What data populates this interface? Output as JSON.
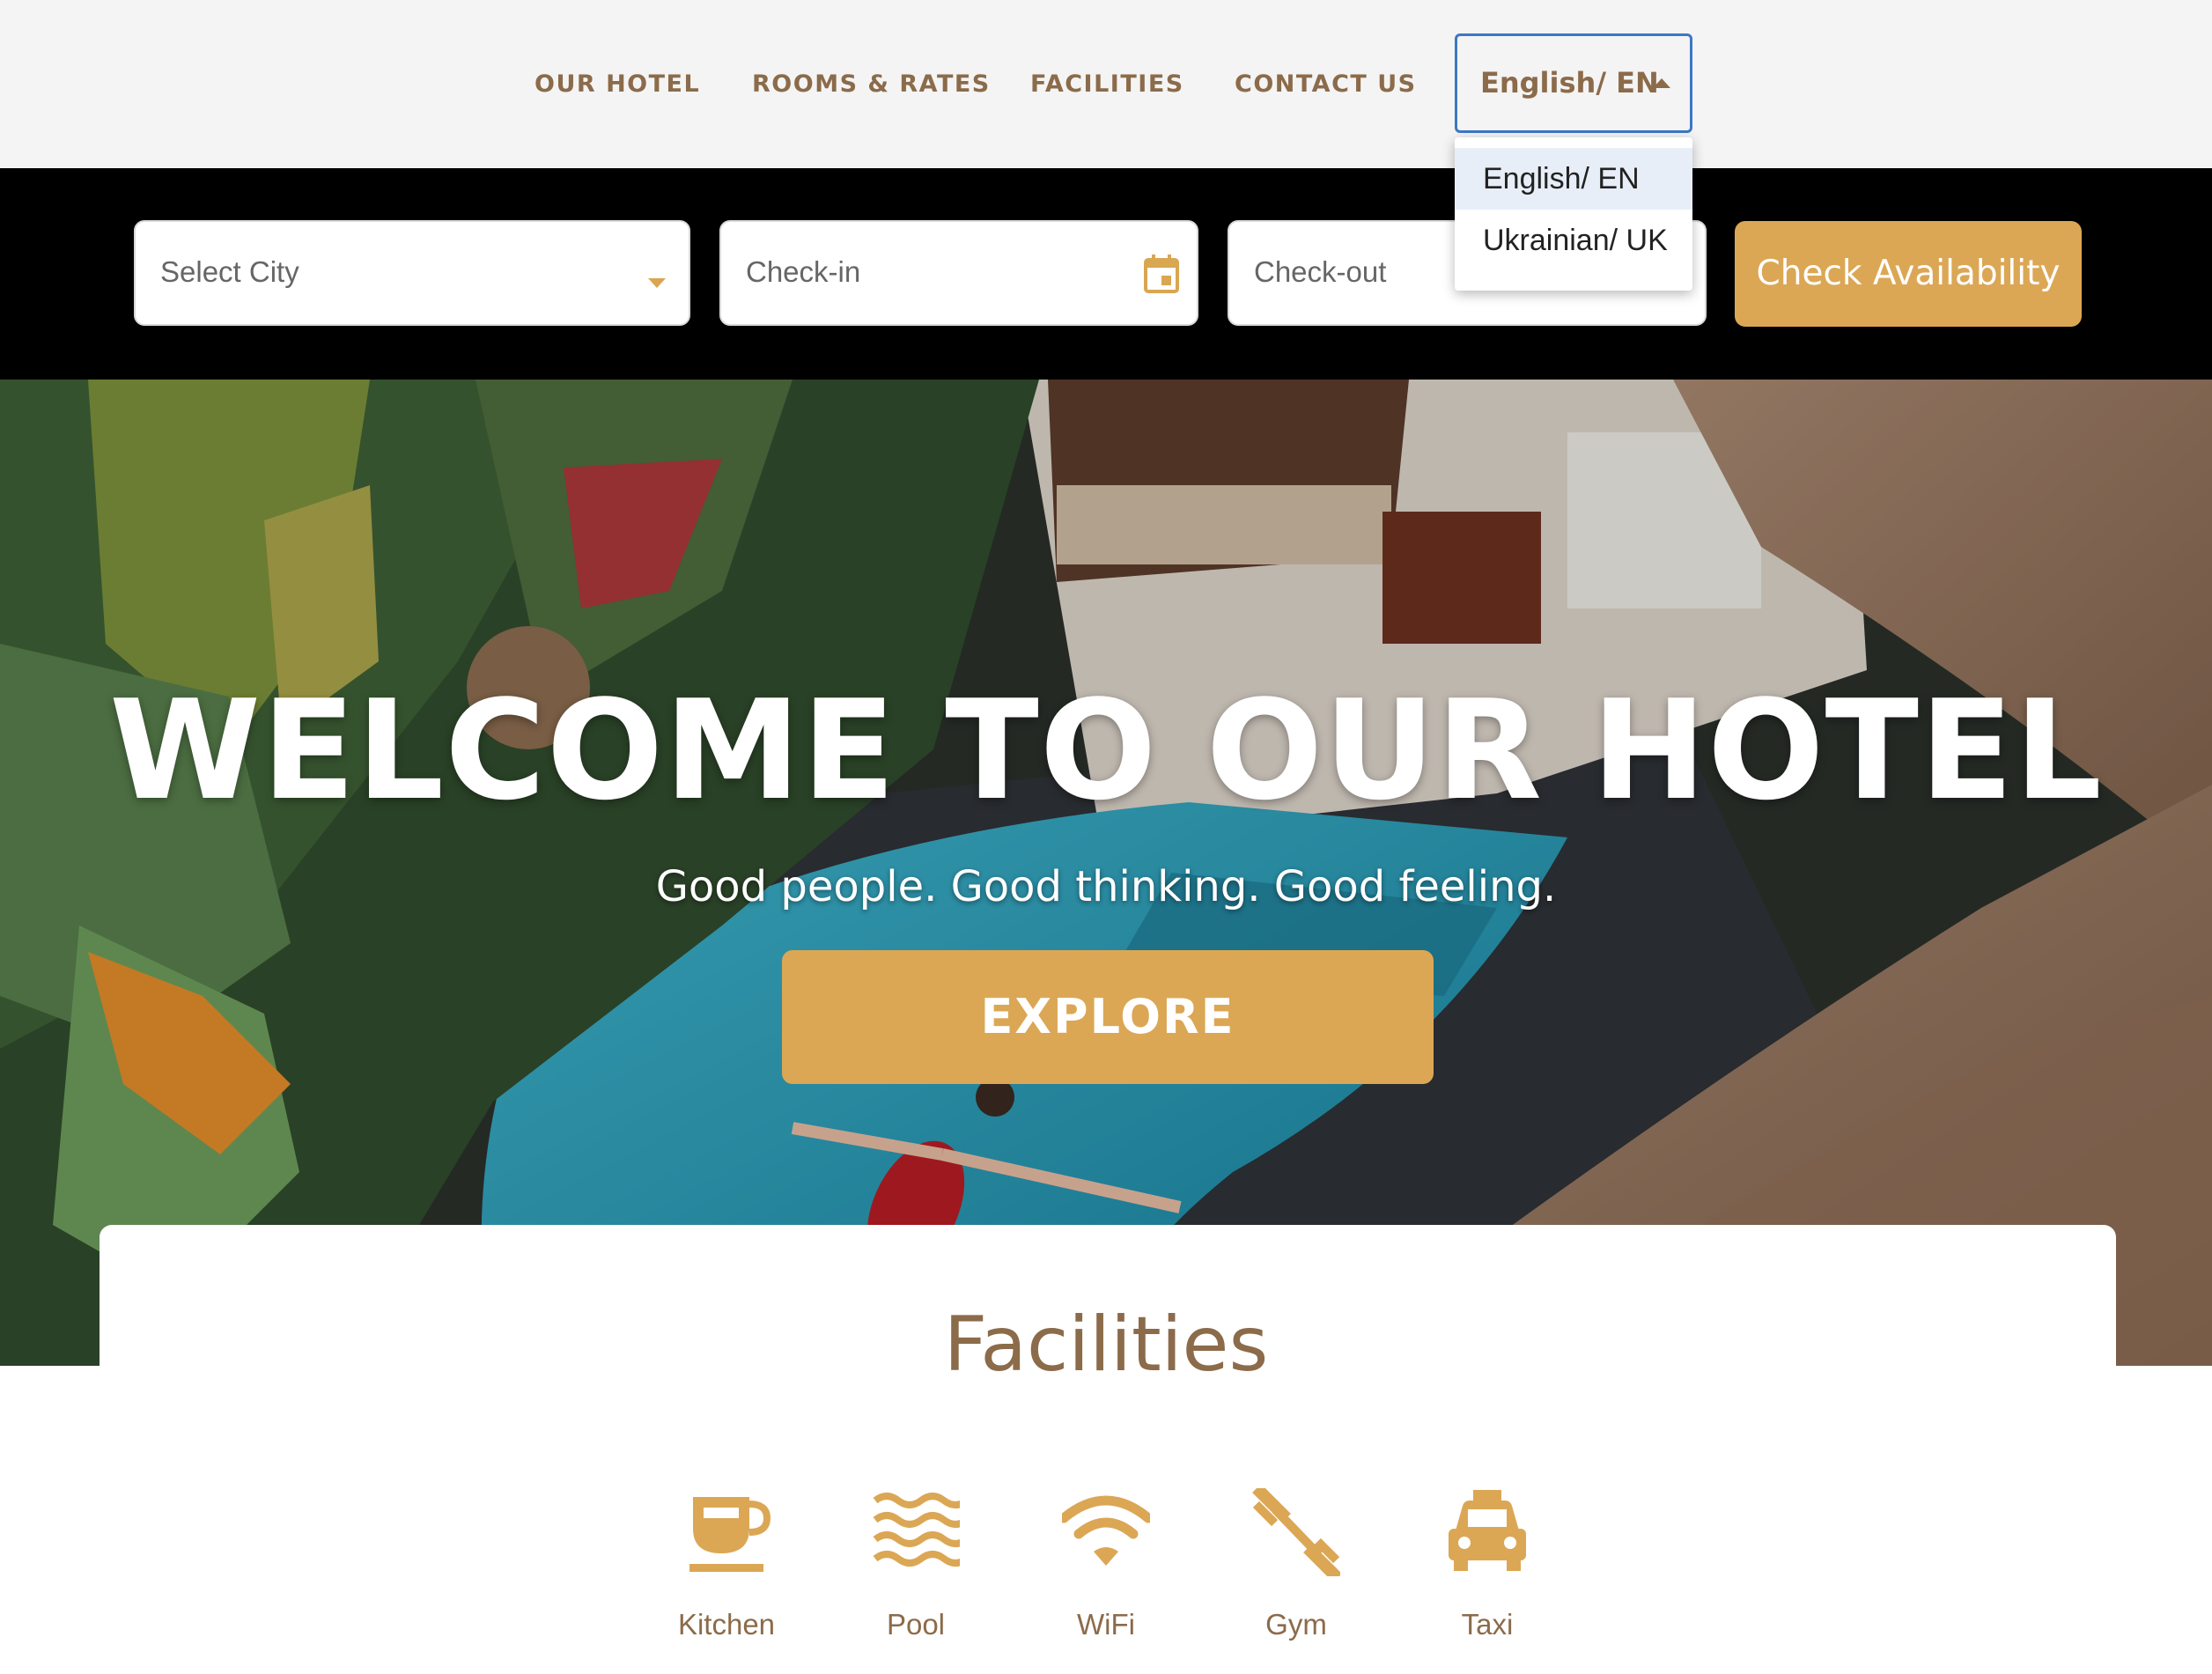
{
  "nav": {
    "links": [
      "OUR HOTEL",
      "ROOMS & RATES",
      "FACILITIES",
      "CONTACT US"
    ],
    "language": {
      "selected": "English/ EN",
      "options": [
        "English/ EN",
        "Ukrainian/ UK"
      ]
    }
  },
  "booking": {
    "city_placeholder": "Select City",
    "checkin_placeholder": "Check-in",
    "checkout_placeholder": "Check-out",
    "check_button": "Check Availability"
  },
  "hero": {
    "title": "WELCOME TO OUR HOTEL",
    "subtitle": "Good people. Good thinking. Good feeling.",
    "explore_button": "EXPLORE"
  },
  "facilities": {
    "title": "Facilities",
    "items": [
      {
        "label": "Kitchen",
        "icon": "coffee-cup-icon"
      },
      {
        "label": "Pool",
        "icon": "waves-icon"
      },
      {
        "label": "WiFi",
        "icon": "wifi-icon"
      },
      {
        "label": "Gym",
        "icon": "dumbbell-icon"
      },
      {
        "label": "Taxi",
        "icon": "taxi-icon"
      }
    ]
  },
  "colors": {
    "accent": "#dba755",
    "brown_text": "#8b6b4a",
    "topbar_bg": "#f4f4f4",
    "booking_bg": "#000000",
    "focus_border": "#3b78c4"
  }
}
